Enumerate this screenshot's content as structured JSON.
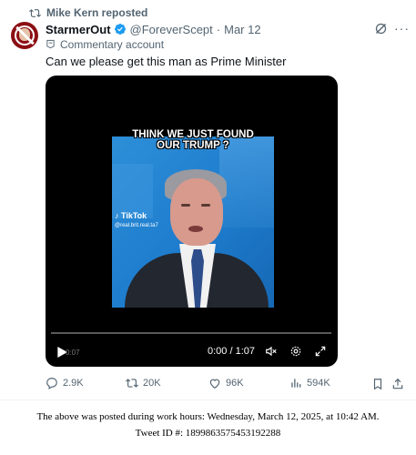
{
  "repost": {
    "text": "Mike Kern reposted"
  },
  "author": {
    "name": "StarmerOut",
    "handle": "@ForeverScept",
    "separator": "·",
    "date": "Mar 12"
  },
  "commentary_label": "Commentary account",
  "tweet_text": "Can we please get this man as Prime Minister",
  "video": {
    "caption_line1": "THINK WE JUST FOUND",
    "caption_line2": "OUR TRUMP ?",
    "watermark_brand": "TikTok",
    "watermark_user": "@real.brit.real.ta7",
    "ghost_time": "0:07",
    "time": "0:00 / 1:07"
  },
  "actions": {
    "replies": "2.9K",
    "reposts": "20K",
    "likes": "96K",
    "views": "594K"
  },
  "footer": {
    "note": "The above was posted during work hours: Wednesday, March 12, 2025, at 10:42 AM.",
    "tweet_id": "Tweet ID #: 1899863575453192288"
  },
  "colors": {
    "text": "#0f1419",
    "muted": "#536471",
    "verified": "#1d9bf0",
    "avatar_bg": "#8b0f14"
  },
  "icons": [
    "repost-icon",
    "verified-badge-icon",
    "grok-icon",
    "more-icon",
    "commentary-icon",
    "play-icon",
    "mute-icon",
    "settings-icon",
    "fullscreen-icon",
    "reply-icon",
    "like-icon",
    "views-icon",
    "bookmark-icon",
    "share-icon"
  ]
}
